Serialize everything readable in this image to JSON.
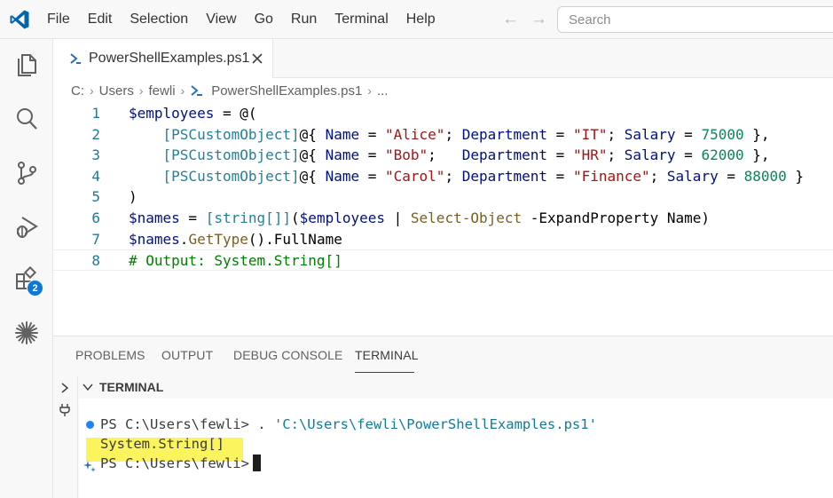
{
  "colors": {
    "accent": "#0f78d4",
    "logo": "#0065a9",
    "highlight": "#fbf45d"
  },
  "menu": [
    "File",
    "Edit",
    "Selection",
    "View",
    "Go",
    "Run",
    "Terminal",
    "Help"
  ],
  "search": {
    "placeholder": "Search"
  },
  "activity": {
    "icons": [
      "explorer-icon",
      "search-icon",
      "source-control-icon",
      "run-debug-icon",
      "extensions-icon",
      "copilot-icon"
    ],
    "extensions_badge": "2"
  },
  "tab": {
    "label": "PowerShellExamples.ps1"
  },
  "breadcrumb": [
    "C:",
    "Users",
    "fewli",
    "PowerShellExamples.ps1",
    "..."
  ],
  "editor": {
    "line_numbers": [
      "1",
      "2",
      "3",
      "4",
      "5",
      "6",
      "7",
      "8"
    ],
    "lines": [
      [
        {
          "t": "$employees",
          "c": "var"
        },
        {
          "t": " = @(",
          "c": "plain"
        }
      ],
      [
        {
          "t": "    ",
          "c": "plain"
        },
        {
          "t": "[PSCustomObject]",
          "c": "type"
        },
        {
          "t": "@{ ",
          "c": "plain"
        },
        {
          "t": "Name",
          "c": "var"
        },
        {
          "t": " = ",
          "c": "plain"
        },
        {
          "t": "\"Alice\"",
          "c": "str"
        },
        {
          "t": "; ",
          "c": "plain"
        },
        {
          "t": "Department",
          "c": "var"
        },
        {
          "t": " = ",
          "c": "plain"
        },
        {
          "t": "\"IT\"",
          "c": "str"
        },
        {
          "t": "; ",
          "c": "plain"
        },
        {
          "t": "Salary",
          "c": "var"
        },
        {
          "t": " = ",
          "c": "plain"
        },
        {
          "t": "75000",
          "c": "num"
        },
        {
          "t": " },",
          "c": "plain"
        }
      ],
      [
        {
          "t": "    ",
          "c": "plain"
        },
        {
          "t": "[PSCustomObject]",
          "c": "type"
        },
        {
          "t": "@{ ",
          "c": "plain"
        },
        {
          "t": "Name",
          "c": "var"
        },
        {
          "t": " = ",
          "c": "plain"
        },
        {
          "t": "\"Bob\"",
          "c": "str"
        },
        {
          "t": ";   ",
          "c": "plain"
        },
        {
          "t": "Department",
          "c": "var"
        },
        {
          "t": " = ",
          "c": "plain"
        },
        {
          "t": "\"HR\"",
          "c": "str"
        },
        {
          "t": "; ",
          "c": "plain"
        },
        {
          "t": "Salary",
          "c": "var"
        },
        {
          "t": " = ",
          "c": "plain"
        },
        {
          "t": "62000",
          "c": "num"
        },
        {
          "t": " },",
          "c": "plain"
        }
      ],
      [
        {
          "t": "    ",
          "c": "plain"
        },
        {
          "t": "[PSCustomObject]",
          "c": "type"
        },
        {
          "t": "@{ ",
          "c": "plain"
        },
        {
          "t": "Name",
          "c": "var"
        },
        {
          "t": " = ",
          "c": "plain"
        },
        {
          "t": "\"Carol\"",
          "c": "str"
        },
        {
          "t": "; ",
          "c": "plain"
        },
        {
          "t": "Department",
          "c": "var"
        },
        {
          "t": " = ",
          "c": "plain"
        },
        {
          "t": "\"Finance\"",
          "c": "str"
        },
        {
          "t": "; ",
          "c": "plain"
        },
        {
          "t": "Salary",
          "c": "var"
        },
        {
          "t": " = ",
          "c": "plain"
        },
        {
          "t": "88000",
          "c": "num"
        },
        {
          "t": " }",
          "c": "plain"
        }
      ],
      [
        {
          "t": ")",
          "c": "plain"
        }
      ],
      [
        {
          "t": "$names",
          "c": "var"
        },
        {
          "t": " = ",
          "c": "plain"
        },
        {
          "t": "[string[]]",
          "c": "type"
        },
        {
          "t": "(",
          "c": "plain"
        },
        {
          "t": "$employees",
          "c": "var"
        },
        {
          "t": " | ",
          "c": "plain"
        },
        {
          "t": "Select-Object",
          "c": "cmd"
        },
        {
          "t": " -ExpandProperty Name)",
          "c": "plain"
        }
      ],
      [
        {
          "t": "$names",
          "c": "var"
        },
        {
          "t": ".",
          "c": "plain"
        },
        {
          "t": "GetType",
          "c": "cmd"
        },
        {
          "t": "().FullName",
          "c": "plain"
        }
      ],
      [
        {
          "t": "# Output: System.String[]",
          "c": "com"
        }
      ]
    ]
  },
  "panel": {
    "tabs": [
      "PROBLEMS",
      "OUTPUT",
      "DEBUG CONSOLE",
      "TERMINAL"
    ],
    "active_tab": "TERMINAL",
    "section_title": "TERMINAL",
    "terminal": {
      "line1_prompt": "PS C:\\Users\\fewli> . ",
      "line1_path": "'C:\\Users\\fewli\\PowerShellExamples.ps1'",
      "line2_output": "System.String[]",
      "line3_prompt": "PS C:\\Users\\fewli>"
    }
  }
}
